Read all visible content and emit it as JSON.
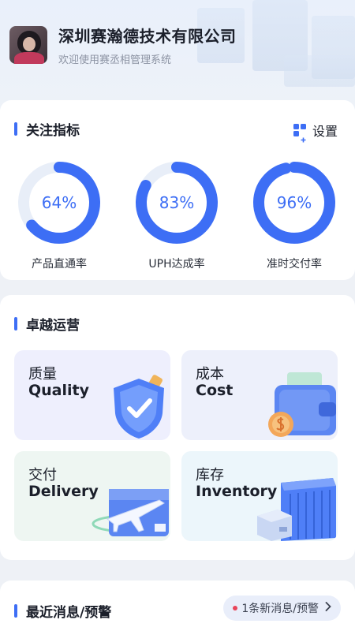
{
  "header": {
    "company_name": "深圳赛瀚德技术有限公司",
    "subtitle": "欢迎使用赛丞相管理系统"
  },
  "kpi": {
    "title": "关注指标",
    "settings_label": "设置",
    "accent_color": "#3d6ef5",
    "items": [
      {
        "value": "64%",
        "label": "产品直通率",
        "fraction": 0.64
      },
      {
        "value": "83%",
        "label": "UPH达成率",
        "fraction": 0.83
      },
      {
        "value": "96%",
        "label": "准时交付率",
        "fraction": 0.96
      }
    ]
  },
  "operations": {
    "title": "卓越运营",
    "tiles": [
      {
        "cn": "质量",
        "en": "Quality",
        "icon": "shield-check-icon",
        "bg": "#eeeffd"
      },
      {
        "cn": "成本",
        "en": "Cost",
        "icon": "wallet-coin-icon",
        "bg": "#edf0fb"
      },
      {
        "cn": "交付",
        "en": "Delivery",
        "icon": "airplane-box-icon",
        "bg": "#eef6f2"
      },
      {
        "cn": "库存",
        "en": "Inventory",
        "icon": "warehouse-icon",
        "bg": "#ecf6fb"
      }
    ]
  },
  "messages": {
    "title": "最近消息/预警",
    "badge": "1条新消息/预警"
  }
}
